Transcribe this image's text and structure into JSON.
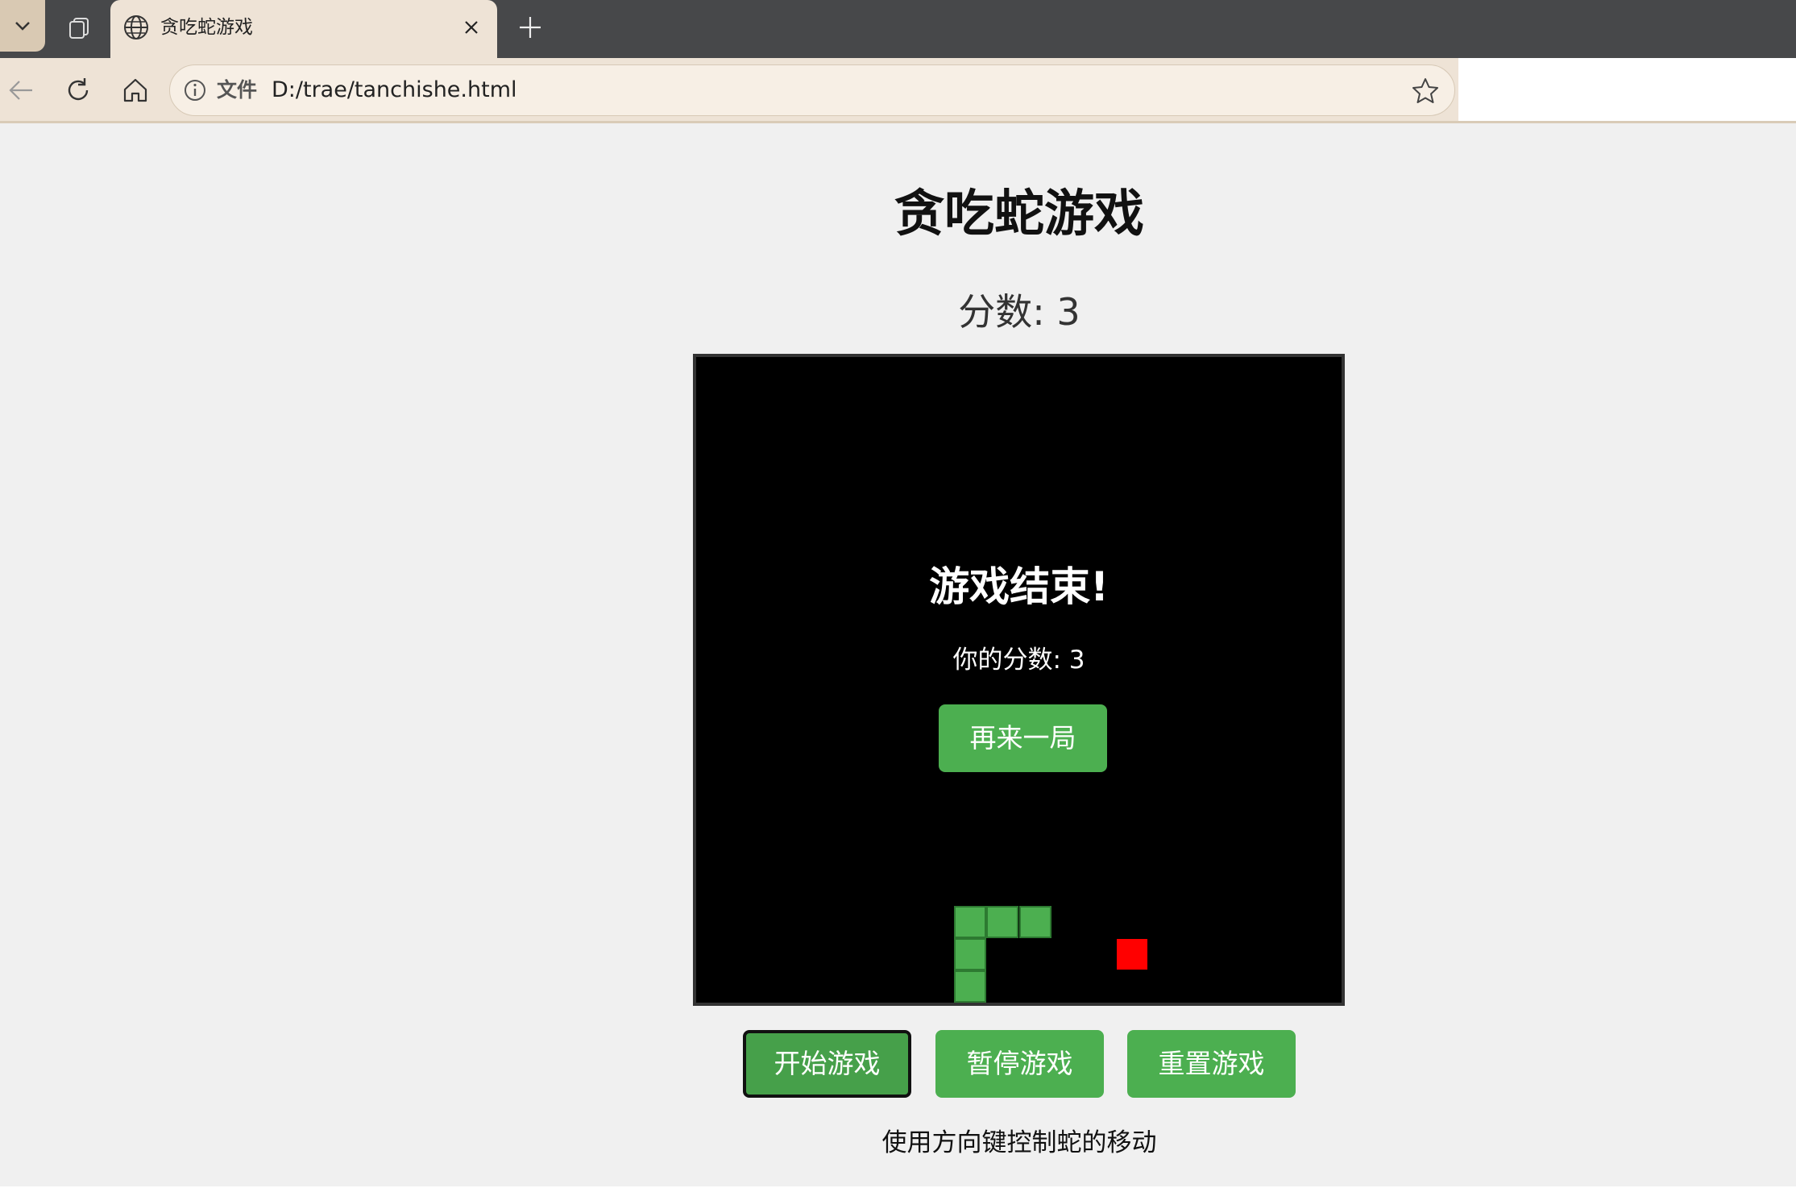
{
  "browser": {
    "tab": {
      "title": "贪吃蛇游戏",
      "icon": "globe-icon"
    },
    "address": {
      "scheme_label": "文件",
      "url": "D:/trae/tanchishe.html"
    },
    "icons": {
      "tab_list": "chevron-down-icon",
      "workspaces": "workspaces-icon",
      "close_tab": "close-icon",
      "new_tab": "plus-icon",
      "back": "back-arrow-icon",
      "reload": "reload-icon",
      "home": "home-icon",
      "info": "info-icon",
      "favorite": "star-icon"
    }
  },
  "page": {
    "title": "贪吃蛇游戏",
    "score_label": "分数: 3",
    "instructions": "使用方向键控制蛇的移动"
  },
  "game": {
    "grid_size": 20,
    "score": 3,
    "snake": [
      {
        "col": 8,
        "row": 17
      },
      {
        "col": 9,
        "row": 17
      },
      {
        "col": 10,
        "row": 17
      },
      {
        "col": 8,
        "row": 18
      },
      {
        "col": 8,
        "row": 19
      }
    ],
    "food": {
      "col": 13,
      "row": 18
    },
    "colors": {
      "snake": "#4caf50",
      "food": "#ff0000",
      "board": "#000000"
    },
    "overlay": {
      "title": "游戏结束!",
      "score_text": "你的分数: 3",
      "button_label": "再来一局"
    }
  },
  "controls": {
    "start_label": "开始游戏",
    "pause_label": "暂停游戏",
    "reset_label": "重置游戏",
    "accent_color": "#4caf50"
  }
}
